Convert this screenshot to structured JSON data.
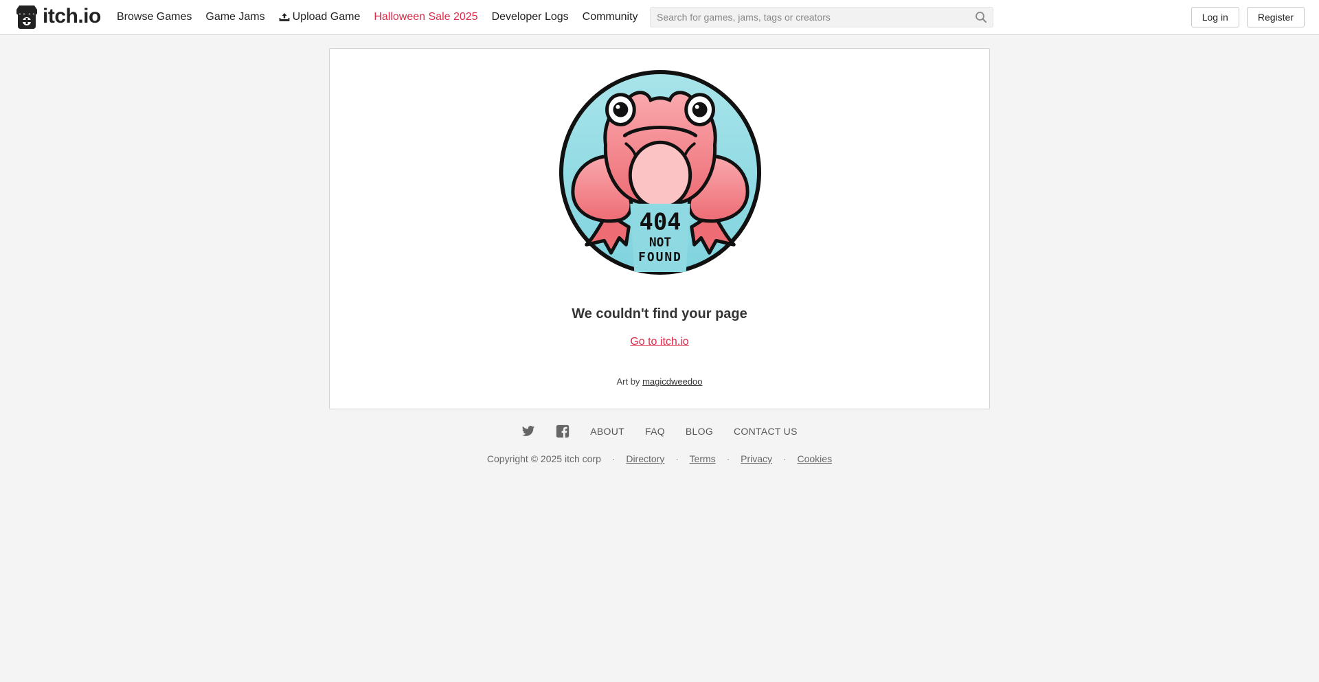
{
  "header": {
    "logo_text": "itch.io",
    "nav": [
      {
        "label": "Browse Games"
      },
      {
        "label": "Game Jams"
      },
      {
        "label": "Upload Game"
      },
      {
        "label": "Halloween Sale 2025"
      },
      {
        "label": "Developer Logs"
      },
      {
        "label": "Community"
      }
    ],
    "search": {
      "placeholder": "Search for games, jams, tags or creators",
      "value": ""
    },
    "login_label": "Log in",
    "register_label": "Register"
  },
  "main": {
    "illustration": {
      "line1": "404",
      "line2": "NOT",
      "line3": "FOUND"
    },
    "headline": "We couldn't find your page",
    "home_link": "Go to itch.io",
    "credit_prefix": "Art by",
    "credit_artist": "magicdweedoo"
  },
  "footer": {
    "social": [
      {
        "icon": "twitter-icon"
      },
      {
        "icon": "facebook-icon"
      }
    ],
    "links": [
      "ABOUT",
      "FAQ",
      "BLOG",
      "CONTACT US"
    ],
    "copyright": "Copyright © 2025 itch corp",
    "legal": [
      "Directory",
      "Terms",
      "Privacy",
      "Cookies"
    ],
    "separator": "·"
  },
  "colors": {
    "accent": "#da2c49",
    "page_bg": "#f4f4f4",
    "card_bg": "#ffffff",
    "frog_circle": "#8fd9e2",
    "frog_body": "#f2848a"
  }
}
